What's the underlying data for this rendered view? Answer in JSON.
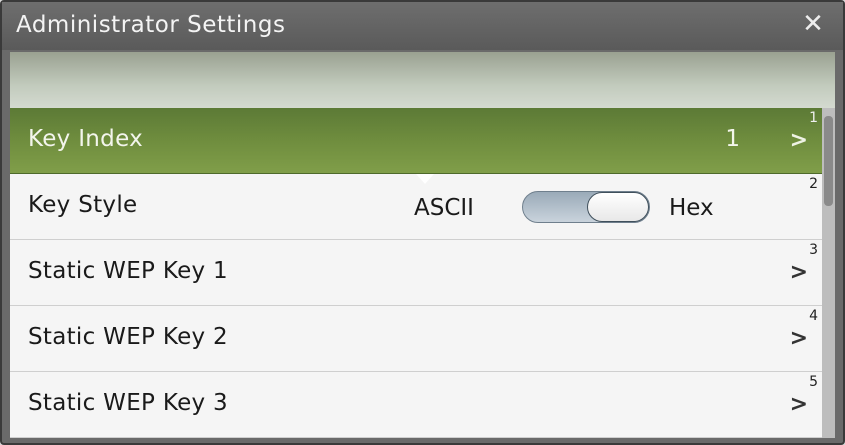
{
  "window": {
    "title": "Administrator Settings",
    "close_icon": "close-icon"
  },
  "rows": [
    {
      "index": "1",
      "label": "Key Index",
      "value": "1",
      "chevron": ">",
      "selected": true
    },
    {
      "index": "2",
      "label": "Key Style",
      "toggle": {
        "left_label": "ASCII",
        "right_label": "Hex",
        "state": "Hex"
      }
    },
    {
      "index": "3",
      "label": "Static WEP Key 1",
      "chevron": ">"
    },
    {
      "index": "4",
      "label": "Static WEP Key 2",
      "chevron": ">"
    },
    {
      "index": "5",
      "label": "Static WEP Key 3",
      "chevron": ">"
    }
  ],
  "colors": {
    "selected_row": "#6f8d3e",
    "titlebar": "#646464"
  }
}
